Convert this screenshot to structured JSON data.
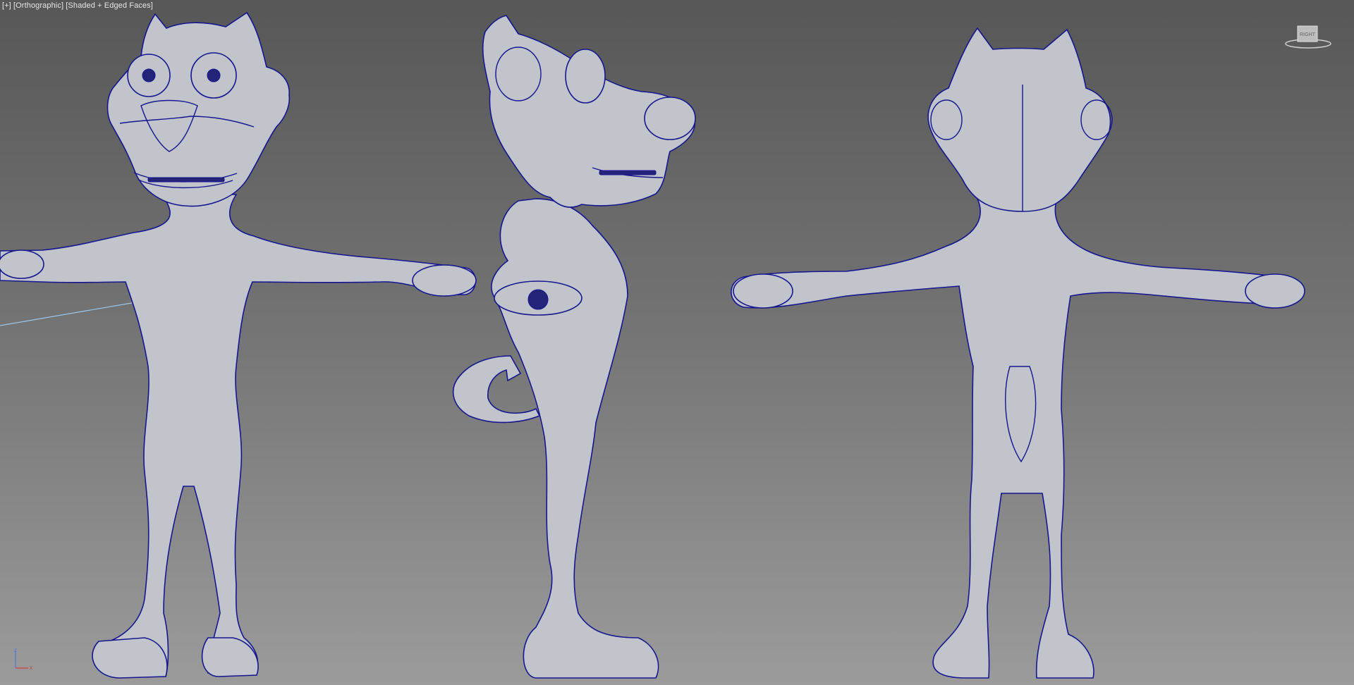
{
  "viewport": {
    "label_plus": "[+]",
    "label_view": "[Orthographic]",
    "label_shading": "[Shaded + Edged Faces]",
    "background_top": "#575757",
    "background_bottom": "#9b9b9b",
    "wire_color": "#16168f",
    "surface_color": "#c2c4cc"
  },
  "viewcube": {
    "face_label": "RIGHT"
  },
  "axis": {
    "x_label": "x",
    "z_label": "z",
    "x_color": "#d04040",
    "z_color": "#4a7ae0"
  },
  "icons": {
    "viewcube": "viewcube-icon",
    "axis": "axis-tripod-icon"
  }
}
